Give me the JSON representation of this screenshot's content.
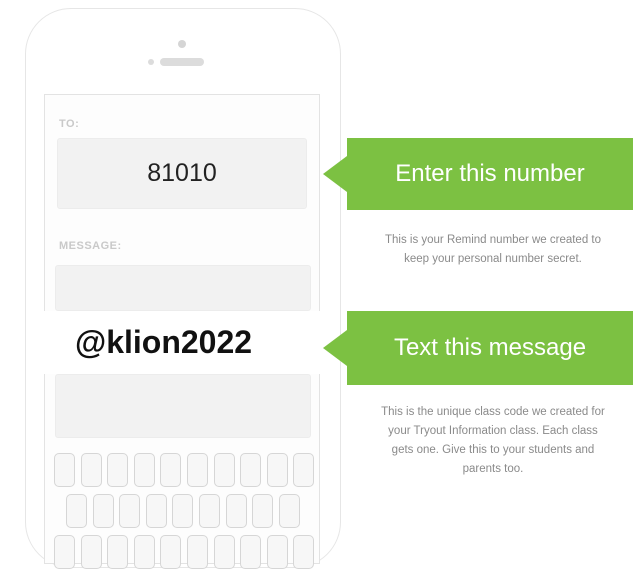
{
  "phone": {
    "to_label": "TO:",
    "to_number": "81010",
    "message_label": "MESSAGE:",
    "class_code": "@klion2022"
  },
  "steps": [
    {
      "title": "Enter this number",
      "description": "This is your Remind number we created to keep your personal number secret."
    },
    {
      "title": "Text this message",
      "description": "This is the unique class code we created for your Tryout Information class. Each class gets one. Give this to your students and parents too."
    }
  ],
  "colors": {
    "accent": "#7cc142",
    "description_text": "#8a8a8a",
    "label_text": "#c9c9c9"
  }
}
